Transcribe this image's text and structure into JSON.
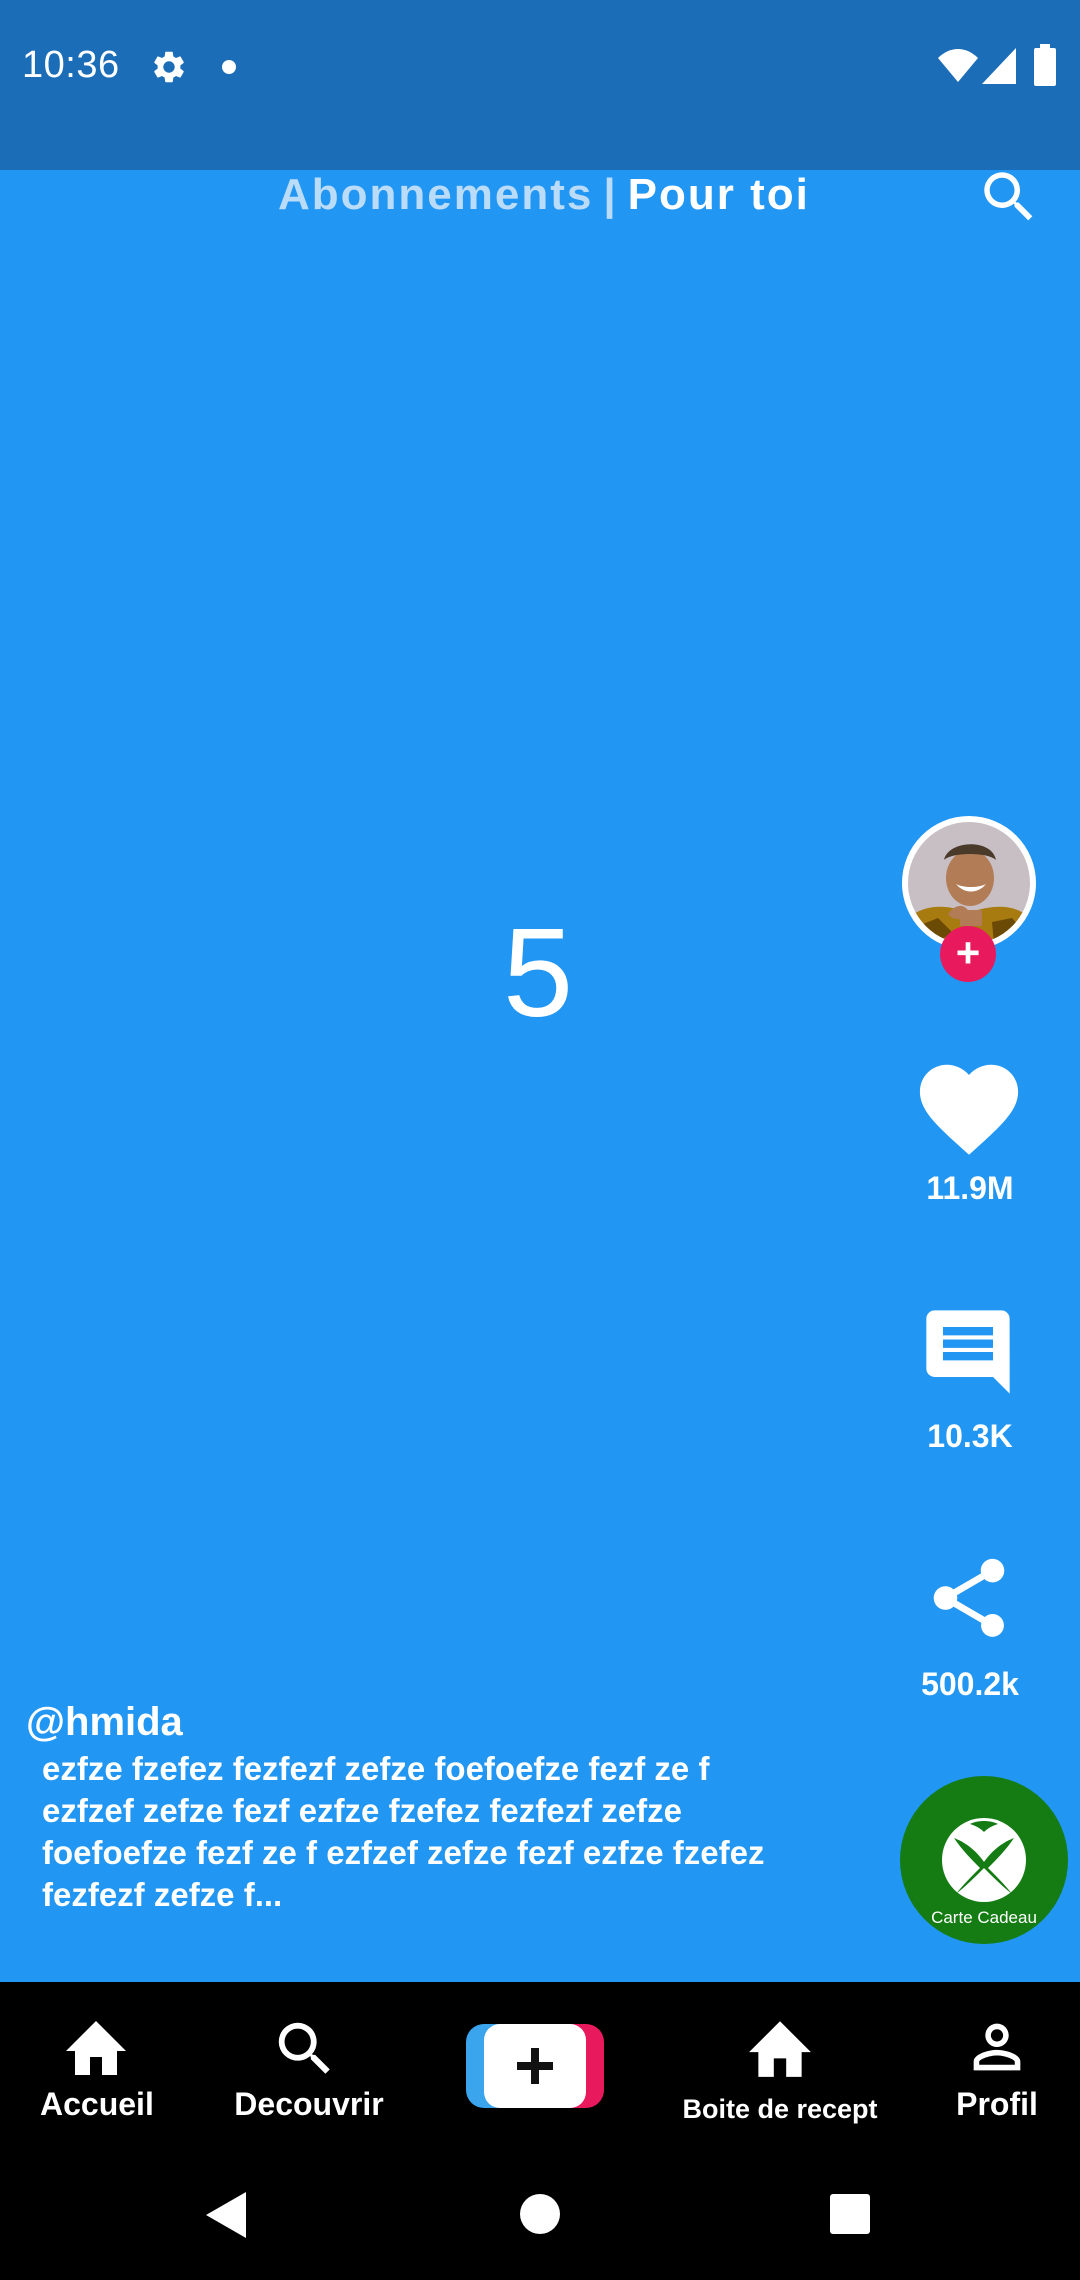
{
  "status_bar": {
    "time": "10:36",
    "icons": [
      "gear-icon",
      "notification-dot",
      "wifi-icon",
      "signal-icon",
      "battery-icon"
    ],
    "background": "#1c6db8"
  },
  "header": {
    "tab_following": "Abonnements",
    "separator": "|",
    "tab_for_you": "Pour toi",
    "search_icon": "search-icon"
  },
  "video": {
    "number": "5",
    "background": "#2196f2"
  },
  "actions": {
    "likes": "11.9M",
    "comments": "10.3K",
    "shares": "500.2k",
    "follow_symbol": "+",
    "follow_color": "#e9195d"
  },
  "gift": {
    "label": "Carte Cadeau",
    "color": "#147c12"
  },
  "caption": {
    "username": "@hmida",
    "description": "ezfze fzefez fezfezf zefze foefoefze fezf ze f ezfzef zefze fezf ezfze fzefez fezfezf zefze foefoefze fezf ze f ezfzef zefze fezf ezfze fzefez fezfezf zefze f..."
  },
  "bottom_nav": {
    "home": "Accueil",
    "discover": "Decouvrir",
    "create_symbol": "+",
    "inbox": "Boite de recept",
    "profile": "Profil"
  }
}
